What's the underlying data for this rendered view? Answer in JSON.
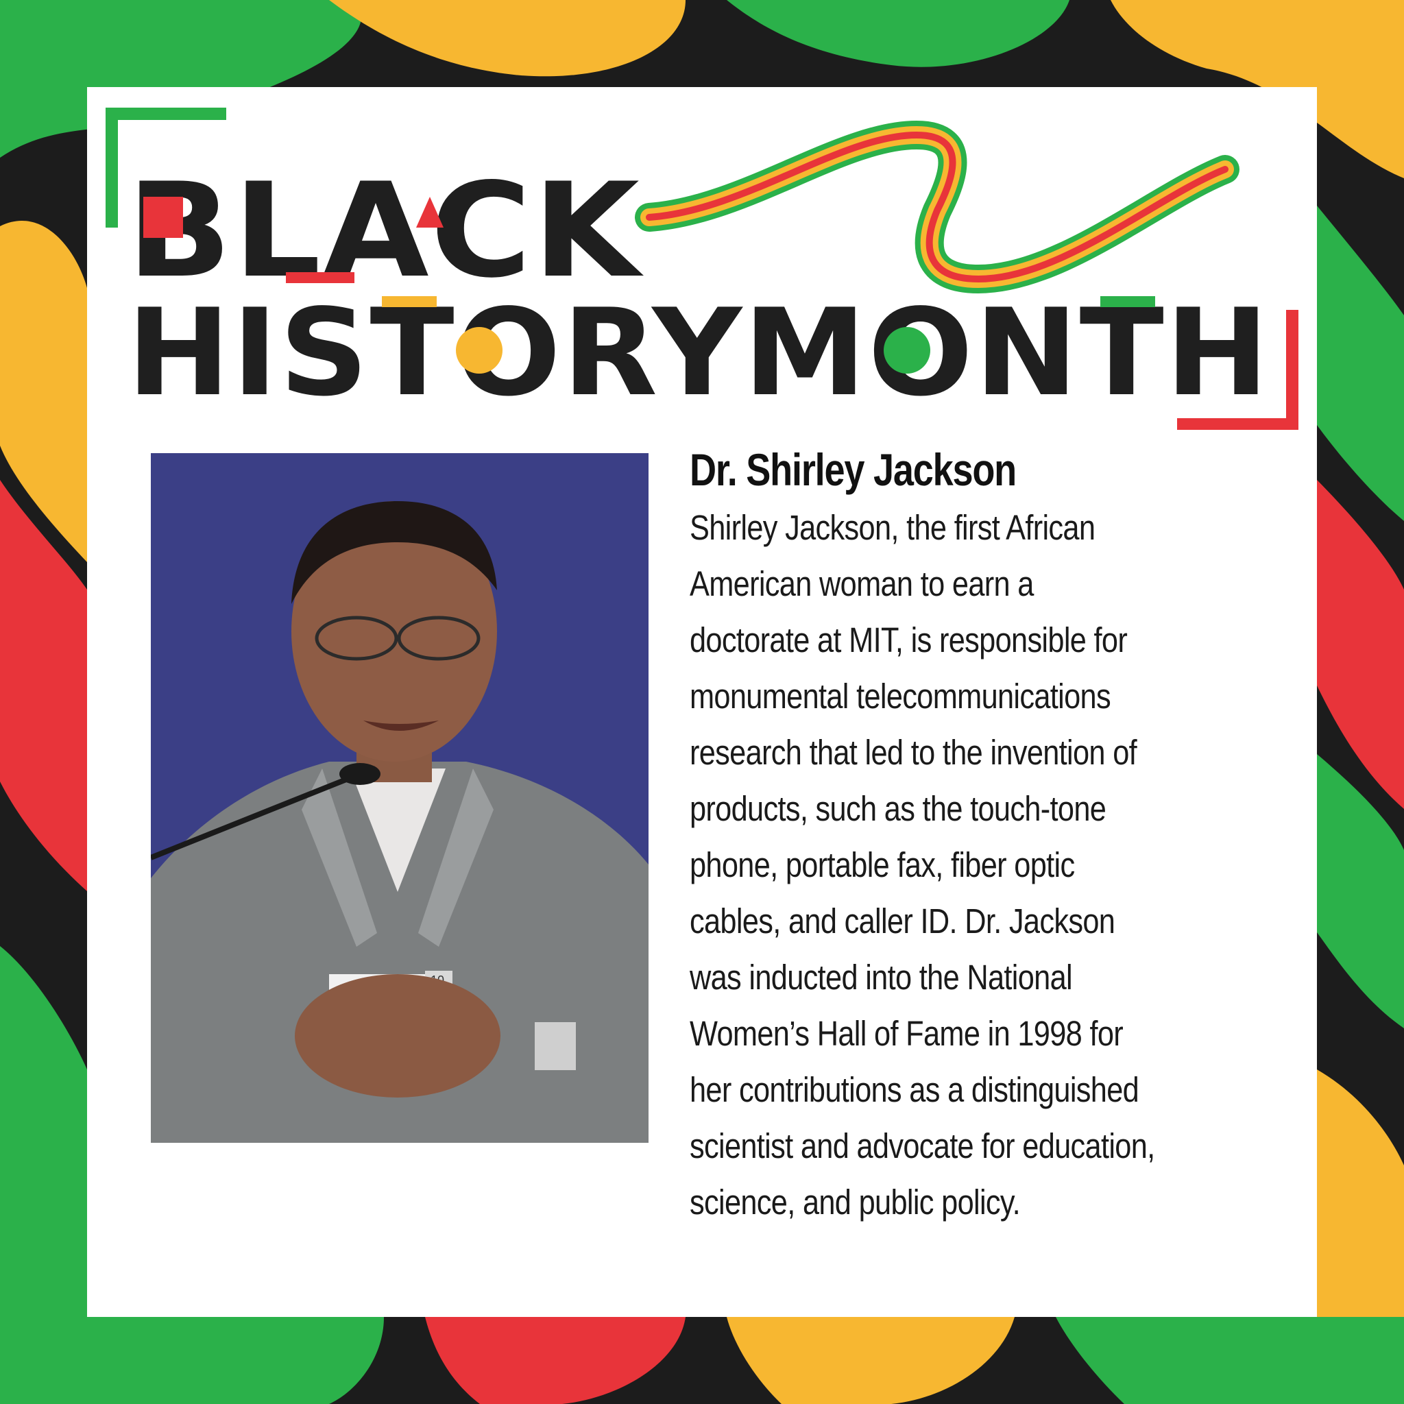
{
  "poster": {
    "title_line1": "BLACK",
    "title_line2": "HISTORYMONTH",
    "colors": {
      "red": "#e8343a",
      "yellow": "#f7b731",
      "green": "#2bb14a",
      "black": "#1c1c1c"
    }
  },
  "profile": {
    "name": "Dr. Shirley Jackson",
    "bio_lines": [
      "Shirley Jackson, the first African",
      "American woman to earn a",
      "doctorate at MIT, is responsible for",
      "monumental telecommunications",
      "research that led to the invention of",
      "products, such as the touch-tone",
      "phone, portable fax, fiber optic",
      "cables, and caller ID. Dr. Jackson",
      "was inducted into the National",
      "Women’s Hall of Fame in 1998 for",
      "her contributions as a distinguished",
      "scientist and advocate for education,",
      "science, and public policy."
    ],
    "badge_text": "10"
  }
}
